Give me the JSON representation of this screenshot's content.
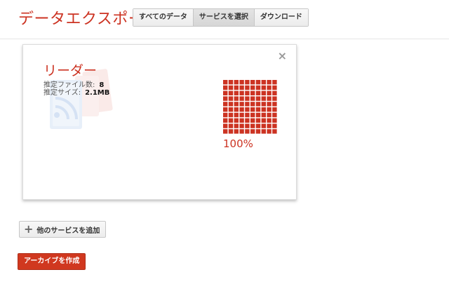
{
  "header": {
    "title": "データエクスポート",
    "tabs": [
      {
        "label": "すべてのデータ"
      },
      {
        "label": "サービスを選択"
      },
      {
        "label": "ダウンロード"
      }
    ]
  },
  "card": {
    "service_name": "リーダー",
    "file_count_label": "推定ファイル数:",
    "file_count": "8",
    "size_label": "推定サイズ:",
    "size": "2.1MB",
    "progress_text": "100%",
    "progress_fraction": 1.0,
    "close_icon": "×"
  },
  "actions": {
    "add_services_label": "他のサービスを追加",
    "create_archive_label": "アーカイブを作成"
  },
  "colors": {
    "accent": "#cc3322",
    "button_primary": "#d0381f"
  }
}
